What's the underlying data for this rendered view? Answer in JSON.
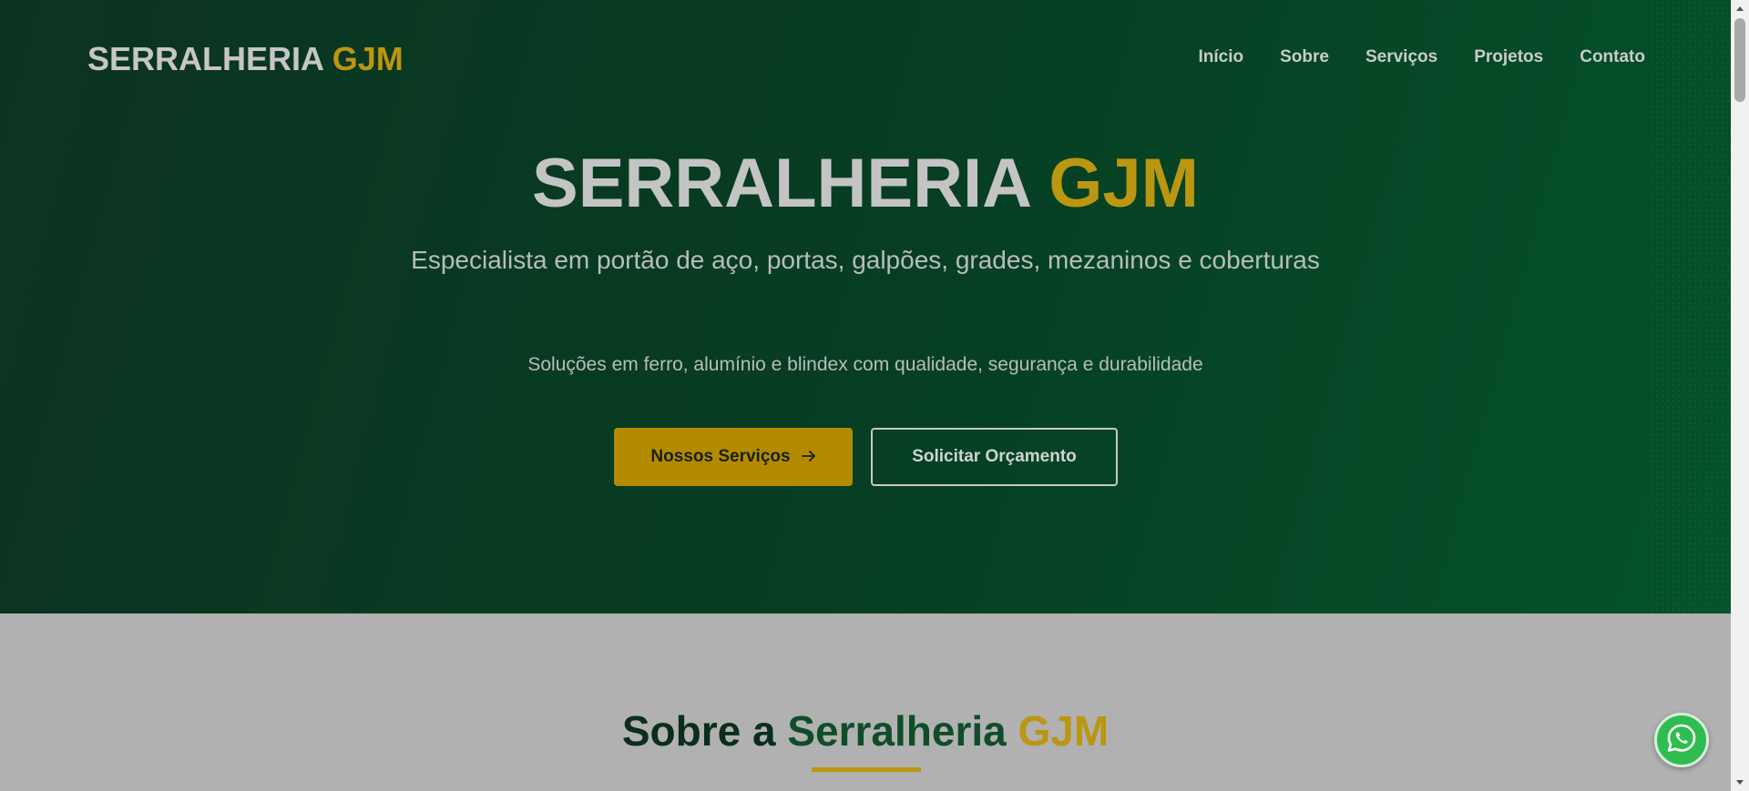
{
  "brand": {
    "name": "SERRALHERIA",
    "accent": "GJM"
  },
  "nav": {
    "items": [
      {
        "label": "Início"
      },
      {
        "label": "Sobre"
      },
      {
        "label": "Serviços"
      },
      {
        "label": "Projetos"
      },
      {
        "label": "Contato"
      }
    ]
  },
  "hero": {
    "title": "SERRALHERIA",
    "title_accent": "GJM",
    "subtitle": "Especialista em portão de aço, portas, galpões, grades, mezaninos e coberturas",
    "tagline": "Soluções em ferro, alumínio e blindex com qualidade, segurança e durabilidade",
    "primary_button": "Nossos Serviços",
    "primary_button_icon": "arrow-right-icon",
    "secondary_button": "Solicitar Orçamento"
  },
  "about": {
    "title_prefix": "Sobre a",
    "title_green": "Serralheria",
    "title_accent": "GJM"
  },
  "whatsapp": {
    "icon": "whatsapp-icon"
  },
  "colors": {
    "hero_dark": "#0c3320",
    "hero_green": "#04522a",
    "gold": "#bb9611",
    "button_gold": "#b38b00",
    "about_bg": "#b1b1b1",
    "whatsapp_green": "#2fbd4f"
  }
}
